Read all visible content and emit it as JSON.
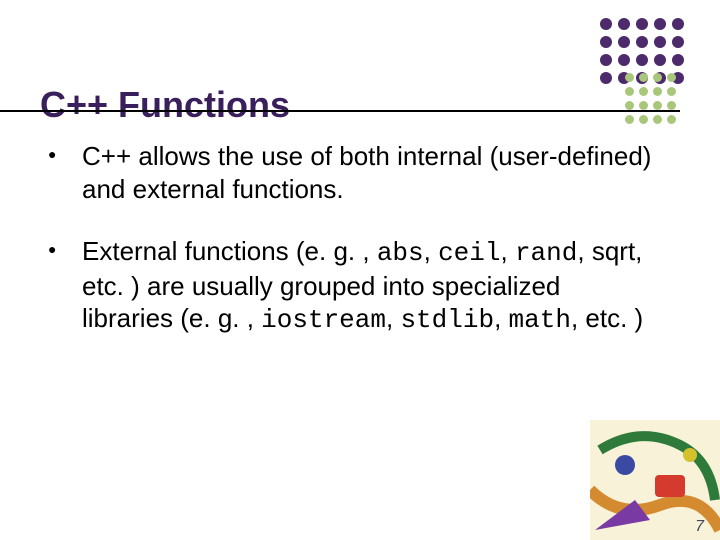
{
  "title": "C++ Functions",
  "bullets": [
    {
      "segments": [
        {
          "text": "C++ allows the use of both internal (user-defined) and external functions.",
          "mono": false
        }
      ]
    },
    {
      "segments": [
        {
          "text": "External functions (e. g. , ",
          "mono": false
        },
        {
          "text": "abs",
          "mono": true
        },
        {
          "text": ", ",
          "mono": false
        },
        {
          "text": "ceil",
          "mono": true
        },
        {
          "text": ", ",
          "mono": false
        },
        {
          "text": "rand",
          "mono": true
        },
        {
          "text": ", sqrt, etc. ) are usually grouped into specialized libraries (e. g. , ",
          "mono": false
        },
        {
          "text": "iostream",
          "mono": true
        },
        {
          "text": ", ",
          "mono": false
        },
        {
          "text": "stdlib",
          "mono": true
        },
        {
          "text": ", ",
          "mono": false
        },
        {
          "text": "math",
          "mono": true
        },
        {
          "text": ", etc. )",
          "mono": false
        }
      ]
    }
  ],
  "page_number": "7",
  "deco": {
    "large_color": "#4c2a6b",
    "light_color": "#a9c77a"
  }
}
